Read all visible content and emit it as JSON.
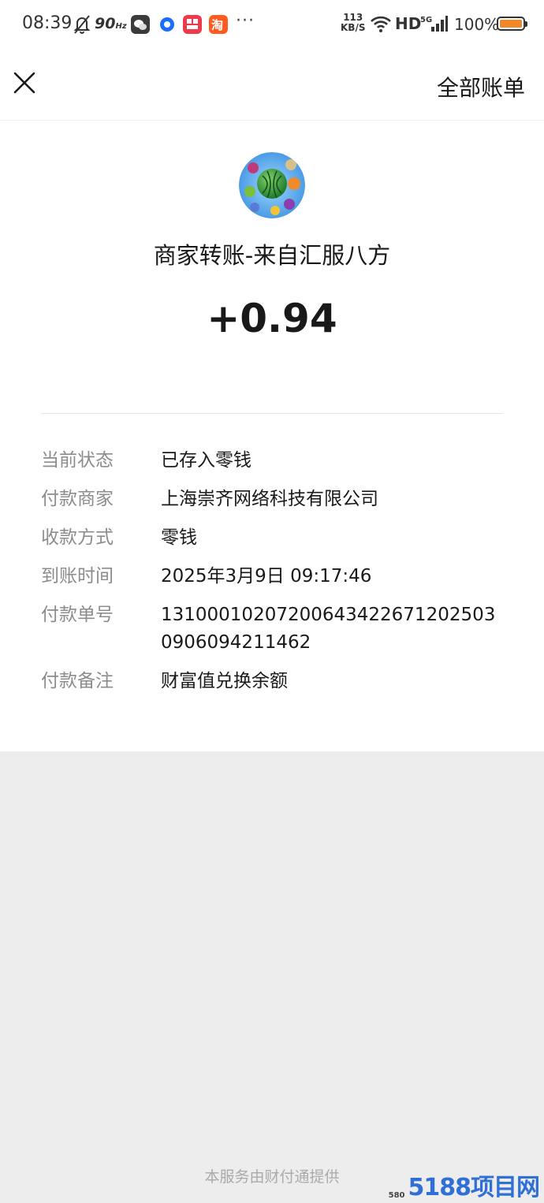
{
  "status_bar": {
    "time": "08:39",
    "refresh_rate": "90",
    "refresh_unit": "Hz",
    "net_speed_value": "113",
    "net_speed_unit": "KB/S",
    "hd": "HD",
    "network": "5G",
    "battery": "100%",
    "more": "···",
    "icons": [
      "mute-icon",
      "wechat-app-icon",
      "browser-app-icon",
      "video-app-icon",
      "taobao-app-icon",
      "wifi-icon",
      "signal-icon",
      "battery-icon"
    ],
    "battery_color": "#f0882a"
  },
  "nav": {
    "close_icon": "close-icon",
    "all_bills": "全部账单"
  },
  "transaction": {
    "title": "商家转账-来自汇服八方",
    "amount": "+0.94"
  },
  "details": [
    {
      "label": "当前状态",
      "value": "已存入零钱"
    },
    {
      "label": "付款商家",
      "value": "上海崇齐网络科技有限公司"
    },
    {
      "label": "收款方式",
      "value": "零钱"
    },
    {
      "label": "到账时间",
      "value": "2025年3月9日 09:17:46"
    },
    {
      "label": "付款单号",
      "value": "131000102072006434226712025030906094211462"
    },
    {
      "label": "付款备注",
      "value": "财富值兑换余额"
    }
  ],
  "footer": {
    "service_note": "本服务由财付通提供"
  },
  "watermark": {
    "small": "580",
    "big": "5188项目网"
  }
}
